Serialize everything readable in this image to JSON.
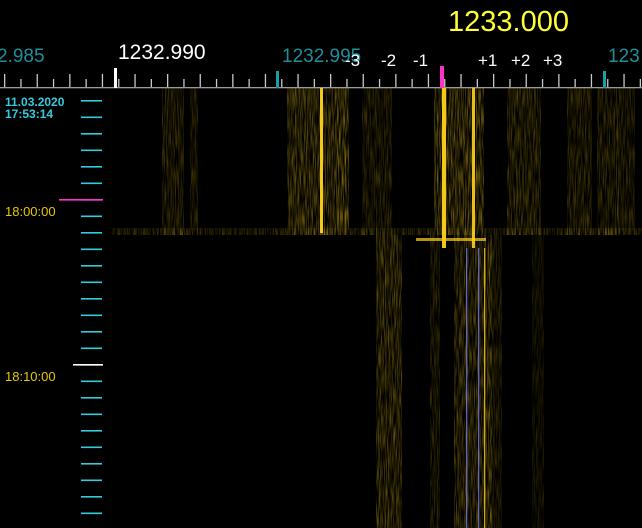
{
  "colors": {
    "background": "#000000",
    "center_frequency": "#ffff33",
    "cursor": "#ff33cc",
    "marker_white": "#ffffff",
    "marker_teal": "#1a9fa5",
    "scale_text_teal": "#1e8f9a",
    "timestamp_cyan": "#33ccdd",
    "time_yellow": "#e8c800",
    "signal": "#ffd21a"
  },
  "frequency_display": {
    "center": "1233.000",
    "left_edge": "2.985",
    "mid_marker": "1232.990",
    "right_marker": "1232.995",
    "far_right": "123"
  },
  "offset_labels": [
    "-3",
    "-2",
    "-1",
    "+1",
    "+2",
    "+3"
  ],
  "time_axis": {
    "date": "11.03.2020",
    "start_time": "17:53:14",
    "labels": [
      "18:00:00",
      "18:10:00"
    ]
  },
  "icons": {
    "cursor": "center-frequency-cursor-icon"
  }
}
